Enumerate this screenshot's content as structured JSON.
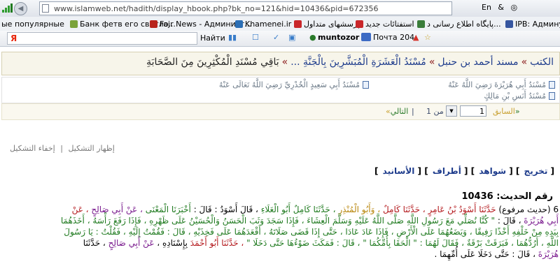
{
  "browser": {
    "url": "www.islamweb.net/hadith/display_hbook.php?bk_no=121&hid=10436&pid=672356",
    "lang_indicator": "En",
    "bookmarks": [
      {
        "label": "ые популярные",
        "color": "#6a7f99"
      },
      {
        "label": "Банк фетв его светло...",
        "color": "#7aa33a"
      },
      {
        "label": "Fajr News - Админист...",
        "color": "#b8231c"
      },
      {
        "label": "Khamenei.ir",
        "color": "#2c6fb5"
      },
      {
        "label": "پرسشهای متداول",
        "color": "#c9272b"
      },
      {
        "label": "استفتائات جدید",
        "color": "#c9272b"
      },
      {
        "label": "پایگاه اطلاع رسانی د...",
        "color": "#3a7d3a"
      },
      {
        "label": "IPB: Админу",
        "color": "#3656a0"
      }
    ],
    "search_logo": "Я",
    "find_label": "Найти",
    "user_label": "muntozor",
    "mail_label": "Почта 204"
  },
  "breadcrumb": {
    "items": [
      "الكتب",
      "مسند أحمد بن حنبل",
      "مُسْنَدُ الْعَشَرَةِ الْمُبَشَّرِينَ بِالْجَنَّةِ ...",
      "بَاقِي مُسْنَدِ الْمُكْثِرِينَ مِنَ الصَّحَابَةِ"
    ],
    "separator": "»"
  },
  "sub_links": [
    {
      "label": "مُسْنَدُ أَبِي هُرَيْرَةَ رَضِيَ اللَّهُ عَنْهُ"
    },
    {
      "label": "مُسْنَدُ أَبِي سَعِيدٍ الْخُدْرِيِّ رَضِيَ اللَّهُ تَعَالَى عَنْهُ"
    },
    {
      "label": "مُسْنَدُ أَنَسِ بْنِ مَالِكٍ"
    }
  ],
  "pager": {
    "prev_label": "السابق",
    "prev_arrow": "«",
    "page_value": "1",
    "of_label": "من 1",
    "next_label": "التالي",
    "next_arrow": "»",
    "separator": "|"
  },
  "display_options": {
    "show_label": "إظهار التشكيل",
    "hide_label": "إخفاء التشكيل",
    "separator": "|"
  },
  "hadith_links": [
    "تخريج",
    "شواهد",
    "أطراف",
    "الأسانيد"
  ],
  "hadith": {
    "number_label": "رقم الحديث:",
    "number": "10436",
    "lines": [
      [
        {
          "text": "6 (حديث مرفوع) ",
          "color": "black"
        },
        {
          "text": "حَدَّثَنَا أَسْوَدُ بْنُ عَامِرٍ ",
          "color": "red"
        },
        {
          "text": "، حَدَّثَنَا كَامِلٌ ",
          "color": "red"
        },
        {
          "text": "، وَأَبُو الْمُنْذِرِ ",
          "color": "gold"
        },
        {
          "text": "، حَدَّثَنَا كَامِلٌ أَبُو الْعَلَاءِ ",
          "color": "green"
        },
        {
          "text": "، قَالَ أَسْوَدُ : قَالَ : ",
          "color": "black"
        },
        {
          "text": "أَخْبَرَنَا الْمَعْنَى ",
          "color": "green"
        },
        {
          "text": "، عَنْ أَبِي صَالِحٍ ",
          "color": "purple"
        },
        {
          "text": "، عَنْ",
          "color": "red"
        }
      ],
      [
        {
          "text": "أَبِي هُرَيْرَةَ ",
          "color": "purple"
        },
        {
          "text": "، قَالَ : ",
          "color": "black"
        },
        {
          "text": "\" كُنَّا نُصَلِّي مَعَ رَسُولِ اللَّهِ صَلَّى اللَّهُ عَلَيْهِ وَسَلَّمَ الْعِشَاءَ ، فَإِذَا سَجَدَ وَثَبَ الْحَسَنُ وَالْحُسَيْنُ عَلَى ظَهْرِهِ ، فَإِذَا رَفَعَ رَأْسَهُ ، أَخَذَهُمَا",
          "color": "green"
        }
      ],
      [
        {
          "text": "بِيَدِهِ مِنْ خَلْفِهِ أَخْذًا رَفِيقًا ، وَيَضَعُهُمَا عَلَى الْأَرْضِ ، فَإِذَا عَادَ عَادَا ، حَتَّى إِذَا قَضَى صَلَاتَهُ ، أَقْعَدَهُمَا عَلَى فَخِذَيْهِ ، قَالَ : فَقُمْتُ إِلَيْهِ ، فَقُلْتُ : يَا رَسُولَ",
          "color": "green"
        }
      ],
      [
        {
          "text": "اللَّهِ ، أَرُدُّهُمَا ، فَبَرَقَتْ بَرْقَةٌ ، فَقَالَ لَهُمَا : \" الْحَقَا بِأُمِّكُمَا \" ، قَالَ : فَمَكَثَ ضَوْءُهَا حَتَّى دَخَلَا \" ",
          "color": "green"
        },
        {
          "text": "، حَدَّثَنَا أَبُو أَحْمَدَ ",
          "color": "red"
        },
        {
          "text": "بِإِسْنَادِهِ ، ",
          "color": "black"
        },
        {
          "text": "عَنْ أَبِي صَالِحٍ ",
          "color": "purple"
        },
        {
          "text": "، حَدَّثَنَا",
          "color": "black"
        }
      ],
      [
        {
          "text": "هُرَيْرَةَ ",
          "color": "purple"
        },
        {
          "text": "، قَالَ : حَتَّى دَخَلَا عَلَى أُمِّهِمَا .",
          "color": "black"
        }
      ]
    ]
  },
  "colors": {
    "black": "#000000",
    "red": "#b3181c",
    "green": "#1f7a1f",
    "purple": "#7a1b8e",
    "blue": "#1e4aa8",
    "gold": "#b8860b"
  }
}
